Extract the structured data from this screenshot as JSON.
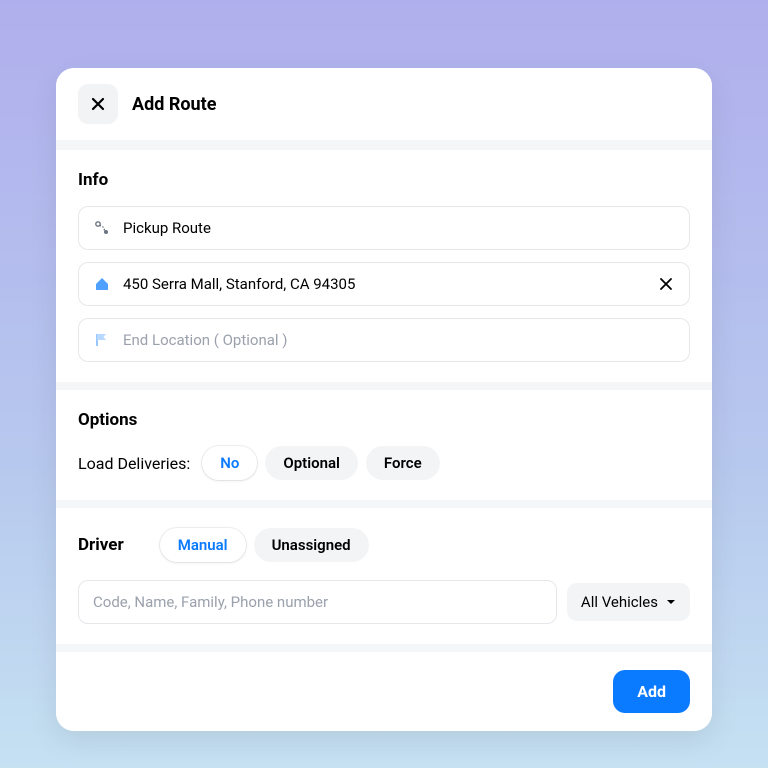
{
  "header": {
    "title": "Add Route"
  },
  "info": {
    "title": "Info",
    "route_name": "Pickup Route",
    "start_location": "450 Serra Mall, Stanford, CA 94305",
    "end_placeholder": "End Location ( Optional )"
  },
  "options": {
    "title": "Options",
    "load_label": "Load Deliveries:",
    "choices": {
      "no": "No",
      "optional": "Optional",
      "force": "Force"
    },
    "selected": "No"
  },
  "driver": {
    "title": "Driver",
    "tabs": {
      "manual": "Manual",
      "unassigned": "Unassigned"
    },
    "selected": "Manual",
    "search_placeholder": "Code, Name, Family, Phone number",
    "vehicle_filter": "All Vehicles"
  },
  "footer": {
    "add_label": "Add"
  },
  "colors": {
    "accent": "#0a7aff"
  }
}
